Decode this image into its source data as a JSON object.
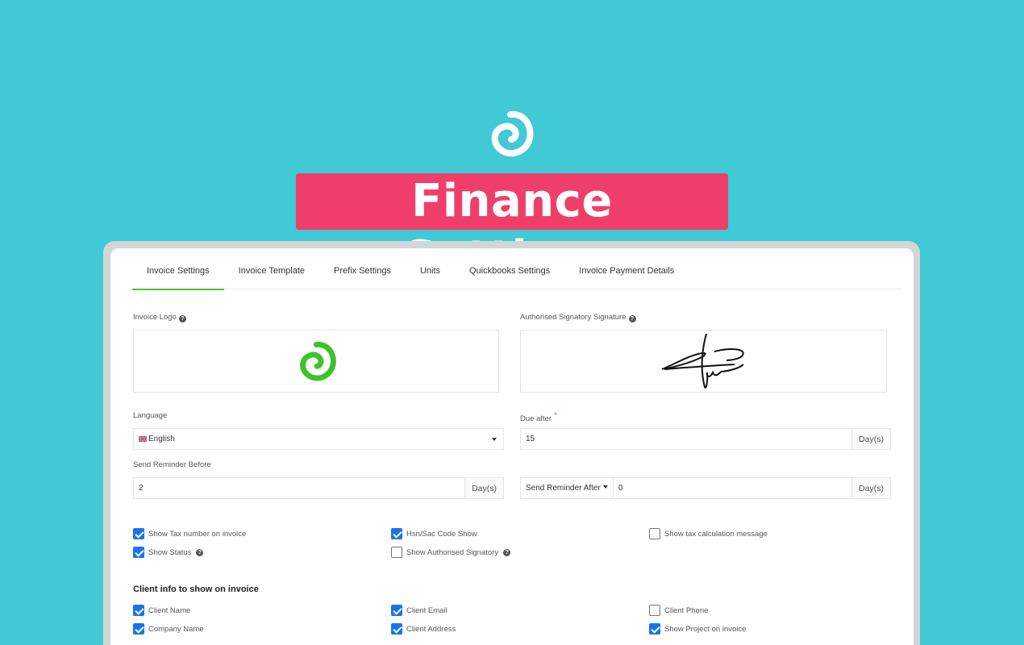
{
  "hero": {
    "title": "Finance Settings"
  },
  "tabs": [
    {
      "label": "Invoice Settings",
      "active": true
    },
    {
      "label": "Invoice Template",
      "active": false
    },
    {
      "label": "Prefix Settings",
      "active": false
    },
    {
      "label": "Units",
      "active": false
    },
    {
      "label": "Quickbooks Settings",
      "active": false
    },
    {
      "label": "Invoice Payment Details",
      "active": false
    }
  ],
  "invoice_logo": {
    "label": "Invoice Logo"
  },
  "signature": {
    "label": "Authorised Signatory Signature"
  },
  "language": {
    "label": "Language",
    "value": "English"
  },
  "due_after": {
    "label": "Due after",
    "required_mark": "*",
    "value": "15",
    "unit": "Day(s)"
  },
  "reminder_before": {
    "label": "Send Reminder Before",
    "value": "2",
    "unit": "Day(s)"
  },
  "reminder_after": {
    "select_label": "Send Reminder After",
    "value": "0",
    "unit": "Day(s)"
  },
  "options": [
    {
      "label": "Show Tax number on invoice",
      "checked": true,
      "help": false
    },
    {
      "label": "Hsn/Sac Code Show",
      "checked": true,
      "help": false
    },
    {
      "label": "Show tax calculation message",
      "checked": false,
      "help": false
    },
    {
      "label": "Show Status",
      "checked": true,
      "help": true
    },
    {
      "label": "Show Authorised Signatory",
      "checked": false,
      "help": true
    }
  ],
  "client_info": {
    "title": "Client info to show on invoice",
    "items": [
      {
        "label": "Client Name",
        "checked": true
      },
      {
        "label": "Client Email",
        "checked": true
      },
      {
        "label": "Client Phone",
        "checked": false
      },
      {
        "label": "Company Name",
        "checked": true
      },
      {
        "label": "Client Address",
        "checked": true
      },
      {
        "label": "Show Project on invoice",
        "checked": true
      }
    ]
  },
  "colors": {
    "background": "#41c9d5",
    "title_bg": "#f03e6a",
    "accent_green": "#4cc12e",
    "checkbox_blue": "#1a73e8"
  }
}
